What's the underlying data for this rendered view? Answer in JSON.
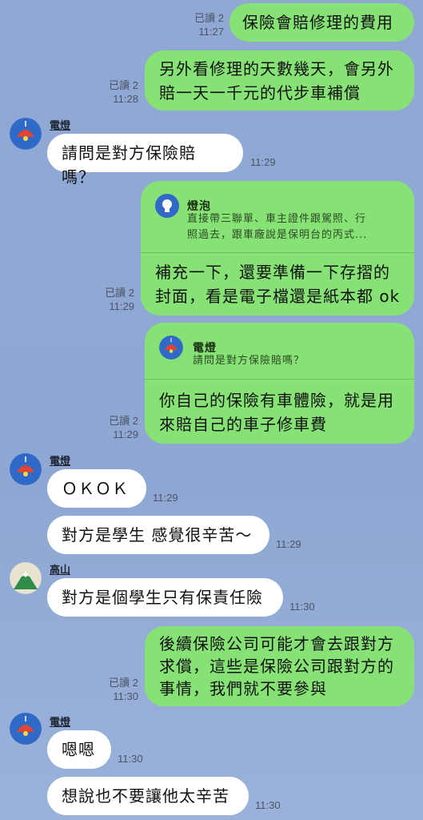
{
  "messages": [
    {
      "text": "保險會賠修理的費用",
      "read": "已讀 2",
      "time": "11:27"
    },
    {
      "text1": "另外看修理的天數幾天，會另外",
      "text2": "賠一天一千元的代步車補償",
      "read": "已讀 2",
      "time": "11:28"
    },
    {
      "sender": "電燈",
      "text": "請問是對方保險賠嗎？",
      "time": "11:29"
    },
    {
      "quote_name": "燈泡",
      "quote1": "直接帶三聯單、車主證件跟駕照、行",
      "quote2": "照過去，跟車廠說是保明台的丙式...",
      "text1": "補充一下，還要準備一下存摺的",
      "text2": "封面，看是電子檔還是紙本都 ok",
      "read": "已讀 2",
      "time": "11:29"
    },
    {
      "quote_name": "電燈",
      "quote1": "請問是對方保險賠嗎？",
      "text1": "你自己的保險有車體險，就是用",
      "text2": "來賠自己的車子修車費",
      "read": "已讀 2",
      "time": "11:29"
    },
    {
      "sender": "電燈",
      "text": "ＯＫＯＫ",
      "time": "11:29"
    },
    {
      "text": "對方是學生 感覺很辛苦～",
      "time": "11:29"
    },
    {
      "sender": "高山",
      "text": "對方是個學生只有保責任險",
      "time": "11:30"
    },
    {
      "text1": "後續保險公司可能才會去跟對方",
      "text2": "求償，這些是保險公司跟對方的",
      "text3": "事情，我們就不要參與",
      "read": "已讀 2",
      "time": "11:30"
    },
    {
      "sender": "電燈",
      "text": "嗯嗯",
      "time": "11:30"
    },
    {
      "text": "想說也不要讓他太辛苦",
      "time": "11:30"
    }
  ],
  "colors": {
    "outgoing": "#87e276",
    "incoming": "#ffffff",
    "background": "#90a9d4"
  }
}
